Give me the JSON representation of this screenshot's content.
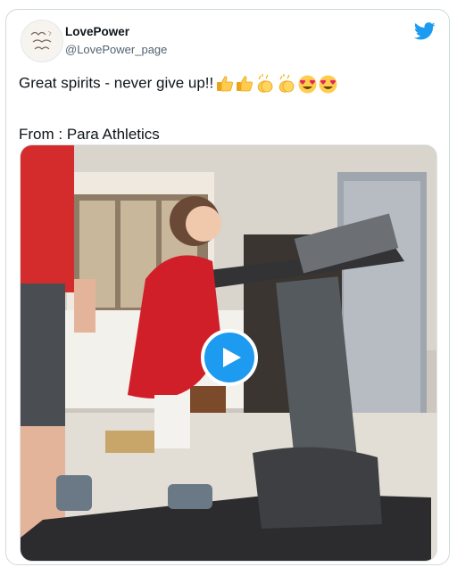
{
  "author": {
    "name": "LovePower",
    "handle": "@LovePower_page",
    "avatar_text": "love laugh live"
  },
  "tweet": {
    "text": "Great spirits - never give up!!",
    "emojis": [
      "thumbs-up",
      "thumbs-up",
      "clapping-hands",
      "clapping-hands",
      "heart-eyes",
      "heart-eyes"
    ],
    "source": "From : Para Athletics"
  },
  "colors": {
    "brand": "#1d9bf0",
    "text": "#0f1419",
    "secondary": "#536471"
  },
  "icons": {
    "platform": "twitter-bird-icon",
    "play": "play-icon"
  }
}
